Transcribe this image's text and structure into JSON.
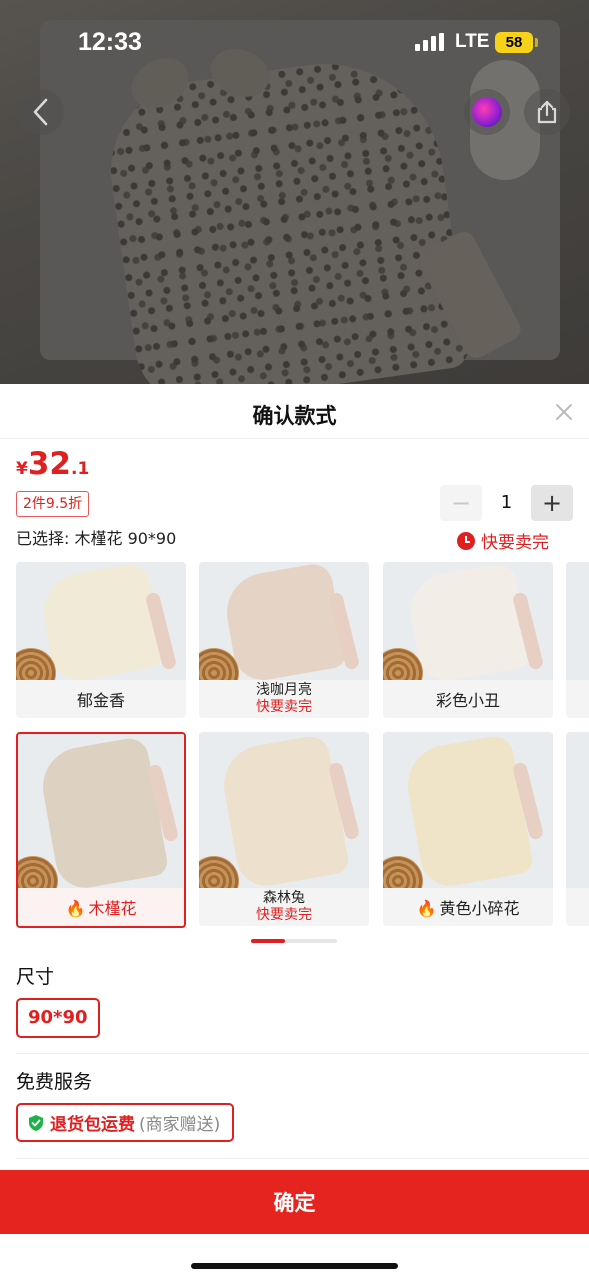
{
  "status_bar": {
    "time": "12:33",
    "network": "LTE",
    "battery": "58"
  },
  "hero": {
    "back_icon": "chevron-left-icon",
    "live_icon": "live-orb-icon",
    "share_icon": "share-icon"
  },
  "sheet": {
    "title": "确认款式",
    "close_icon": "close-icon",
    "price": {
      "currency": "¥",
      "integer": "32",
      "decimal": ".1"
    },
    "discount_tag": "2件9.5折",
    "selected_label": "已选择: 木槿花 90*90",
    "quantity": {
      "minus": "−",
      "value": "1",
      "plus": "+"
    },
    "selling_fast": "快要卖完",
    "variants": [
      {
        "name": "郁金香",
        "tag": ""
      },
      {
        "name": "浅咖月亮",
        "tag": "快要卖完"
      },
      {
        "name": "彩色小丑",
        "tag": ""
      },
      {
        "name": "木槿花",
        "tag": "",
        "hot": true,
        "selected": true
      },
      {
        "name": "森林兔",
        "tag": "快要卖完"
      },
      {
        "name": "黄色小碎花",
        "tag": "",
        "hot": true
      }
    ],
    "hot_icon": "fire-icon",
    "size_section": {
      "title": "尺寸",
      "options": [
        "90*90"
      ]
    },
    "service_section": {
      "title": "免费服务",
      "chip_main": "退货包运费",
      "chip_note": "(商家赠送)"
    },
    "confirm_label": "确定"
  },
  "colors": {
    "accent": "#e5231f",
    "price": "#e02020"
  }
}
